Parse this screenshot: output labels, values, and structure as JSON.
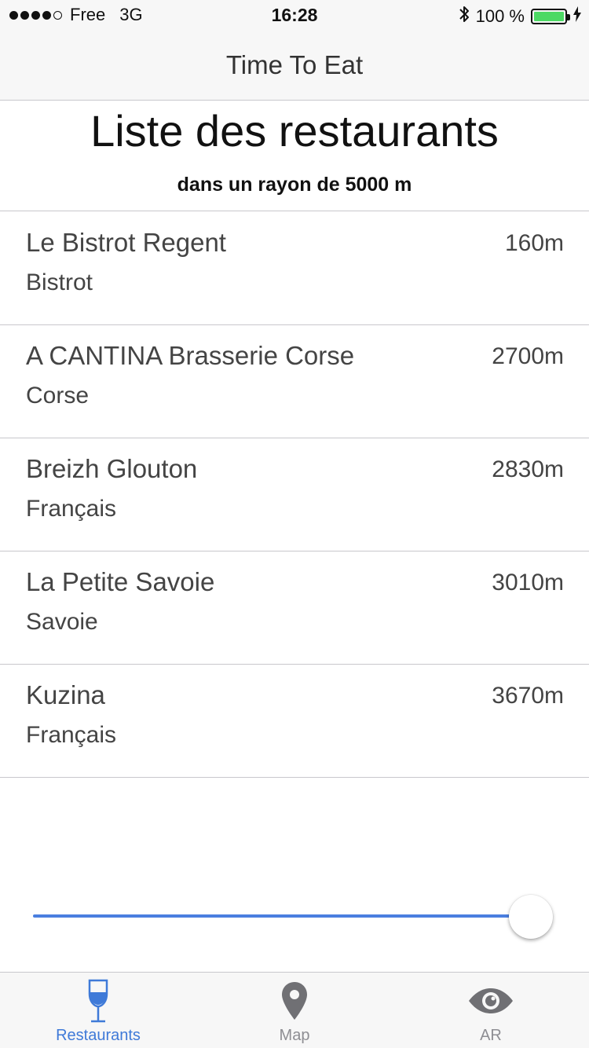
{
  "status_bar": {
    "carrier": "Free",
    "network": "3G",
    "time": "16:28",
    "battery_percent": "100 %",
    "icons": [
      "signal-dots-icon",
      "bluetooth-icon",
      "battery-icon",
      "charging-icon"
    ],
    "battery_color": "#4cd964"
  },
  "nav": {
    "title": "Time To Eat"
  },
  "header": {
    "title": "Liste des restaurants",
    "subtitle": "dans un rayon de 5000 m"
  },
  "restaurants": [
    {
      "name": "Le Bistrot Regent",
      "category": "Bistrot",
      "distance": "160m"
    },
    {
      "name": "A CANTINA Brasserie Corse",
      "category": "Corse",
      "distance": "2700m"
    },
    {
      "name": "Breizh Glouton",
      "category": "Français",
      "distance": "2830m"
    },
    {
      "name": "La Petite Savoie",
      "category": "Savoie",
      "distance": "3010m"
    },
    {
      "name": "Kuzina",
      "category": "Français",
      "distance": "3670m"
    }
  ],
  "slider": {
    "value_fraction": 1.0,
    "track_color": "#4a7fe0"
  },
  "tabs": [
    {
      "label": "Restaurants",
      "icon": "wine-glass-icon",
      "active": true
    },
    {
      "label": "Map",
      "icon": "map-pin-icon",
      "active": false
    },
    {
      "label": "AR",
      "icon": "eye-icon",
      "active": false
    }
  ],
  "colors": {
    "accent": "#3f7ad8",
    "inactive": "#8e8e93"
  }
}
